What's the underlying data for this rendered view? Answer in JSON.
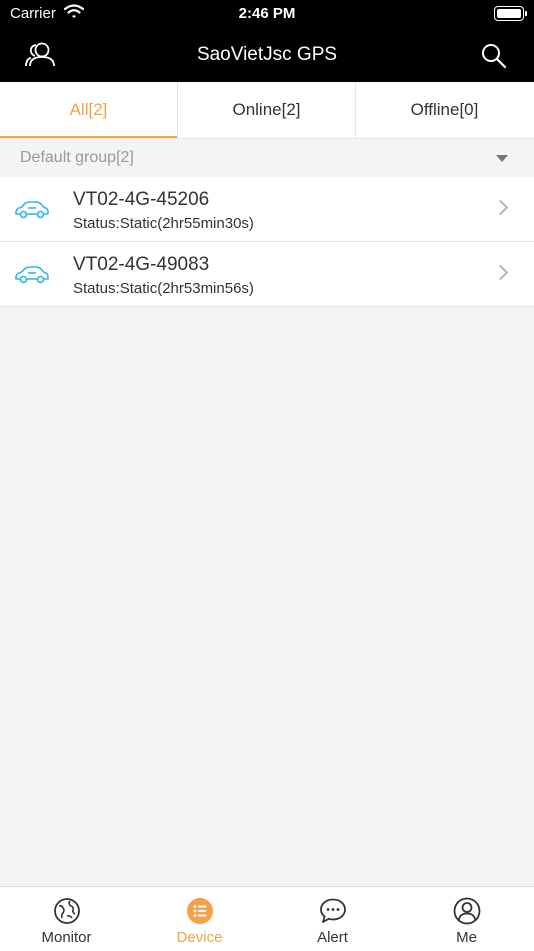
{
  "status_bar": {
    "carrier": "Carrier",
    "time": "2:46 PM"
  },
  "header": {
    "title": "SaoVietJsc GPS",
    "left_icon": "users-icon",
    "right_icon": "search-icon"
  },
  "tabs": [
    {
      "label": "All[2]",
      "active": true
    },
    {
      "label": "Online[2]",
      "active": false
    },
    {
      "label": "Offline[0]",
      "active": false
    }
  ],
  "group": {
    "label": "Default group[2]"
  },
  "devices": [
    {
      "name": "VT02-4G-45206",
      "status": "Status:Static(2hr55min30s)",
      "icon": "car-icon"
    },
    {
      "name": "VT02-4G-49083",
      "status": "Status:Static(2hr53min56s)",
      "icon": "car-icon"
    }
  ],
  "bottom_tabs": [
    {
      "label": "Monitor",
      "icon": "globe-icon",
      "active": false
    },
    {
      "label": "Device",
      "icon": "list-icon",
      "active": true
    },
    {
      "label": "Alert",
      "icon": "chat-bubble-icon",
      "active": false
    },
    {
      "label": "Me",
      "icon": "user-icon",
      "active": false
    }
  ],
  "colors": {
    "accent": "#f5a04a",
    "car_icon": "#2eb7e6",
    "header_bg": "#000000"
  }
}
